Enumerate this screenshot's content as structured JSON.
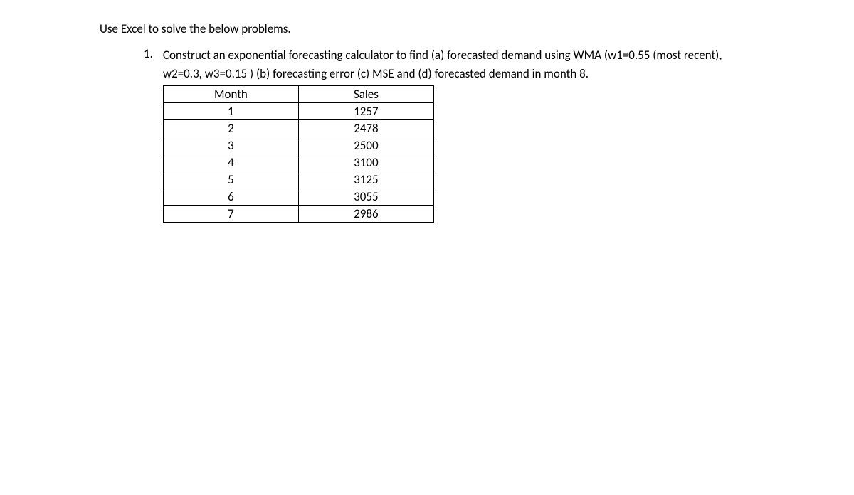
{
  "intro": "Use Excel to solve the below problems.",
  "problem": {
    "number": "1.",
    "text": "Construct an exponential forecasting calculator to find (a) forecasted demand using WMA (w1=0.55 (most recent), w2=0.3, w3=0.15 ) (b) forecasting error (c) MSE and (d) forecasted demand in month 8."
  },
  "table": {
    "headers": [
      "Month",
      "Sales"
    ],
    "rows": [
      [
        "1",
        "1257"
      ],
      [
        "2",
        "2478"
      ],
      [
        "3",
        "2500"
      ],
      [
        "4",
        "3100"
      ],
      [
        "5",
        "3125"
      ],
      [
        "6",
        "3055"
      ],
      [
        "7",
        "2986"
      ]
    ]
  }
}
